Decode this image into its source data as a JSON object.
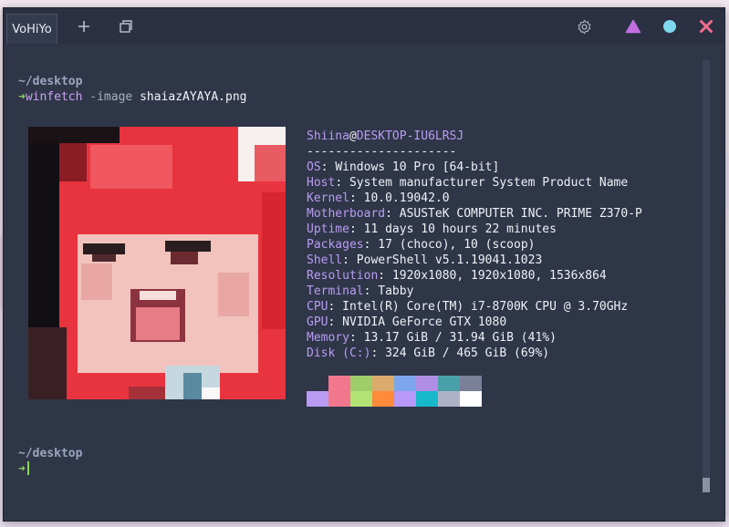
{
  "tab": {
    "title": "VoHiYo"
  },
  "toolbar": {
    "new_tab_icon": "plus-icon",
    "tabs_icon": "window-stack-icon",
    "settings_icon": "gear-icon",
    "minimize_icon": "triangle-icon",
    "maximize_icon": "circle-icon",
    "close_icon": "x-icon",
    "colors": {
      "minimize": "#c16fe0",
      "maximize": "#7fd7ee",
      "close": "#f16d8d"
    }
  },
  "terminal": {
    "prompt1": {
      "dir": "~/desktop",
      "arrow": "➜",
      "command": "winfetch",
      "flag": "-image",
      "arg": "shaiazAYAYA.png"
    },
    "header": {
      "user": "Shiina",
      "at": "@",
      "host": "DESKTOP-IU6LRSJ"
    },
    "separator": "---------------------",
    "info": [
      {
        "key": "OS",
        "value": "Windows 10 Pro [64-bit]"
      },
      {
        "key": "Host",
        "value": "System manufacturer System Product Name"
      },
      {
        "key": "Kernel",
        "value": "10.0.19042.0"
      },
      {
        "key": "Motherboard",
        "value": "ASUSTeK COMPUTER INC. PRIME Z370-P"
      },
      {
        "key": "Uptime",
        "value": "11 days 10 hours 22 minutes"
      },
      {
        "key": "Packages",
        "value": "17 (choco), 10 (scoop)"
      },
      {
        "key": "Shell",
        "value": "PowerShell v5.1.19041.1023"
      },
      {
        "key": "Resolution",
        "value": "1920x1080, 1920x1080, 1536x864"
      },
      {
        "key": "Terminal",
        "value": "Tabby"
      },
      {
        "key": "CPU",
        "value": "Intel(R) Core(TM) i7-8700K CPU @ 3.70GHz"
      },
      {
        "key": "GPU",
        "value": "NVIDIA GeForce GTX 1080"
      },
      {
        "key": "Memory",
        "value": "13.17 GiB / 31.94 GiB (41%)"
      },
      {
        "key": "Disk (C:)",
        "value": "324 GiB / 465 GiB (69%)"
      }
    ],
    "palette_top": [
      "#2f3648",
      "#f2778d",
      "#9fcd6a",
      "#dcaa6a",
      "#7ea6ee",
      "#b08ee6",
      "#4aa0a8",
      "#7a8098"
    ],
    "palette_bottom": [
      "#b99cf2",
      "#f2778d",
      "#b3e274",
      "#ff8a3a",
      "#b898f8",
      "#17b8c9",
      "#aeb2c8",
      "#ffffff"
    ],
    "prompt2": {
      "dir": "~/desktop",
      "arrow": "➜"
    }
  }
}
